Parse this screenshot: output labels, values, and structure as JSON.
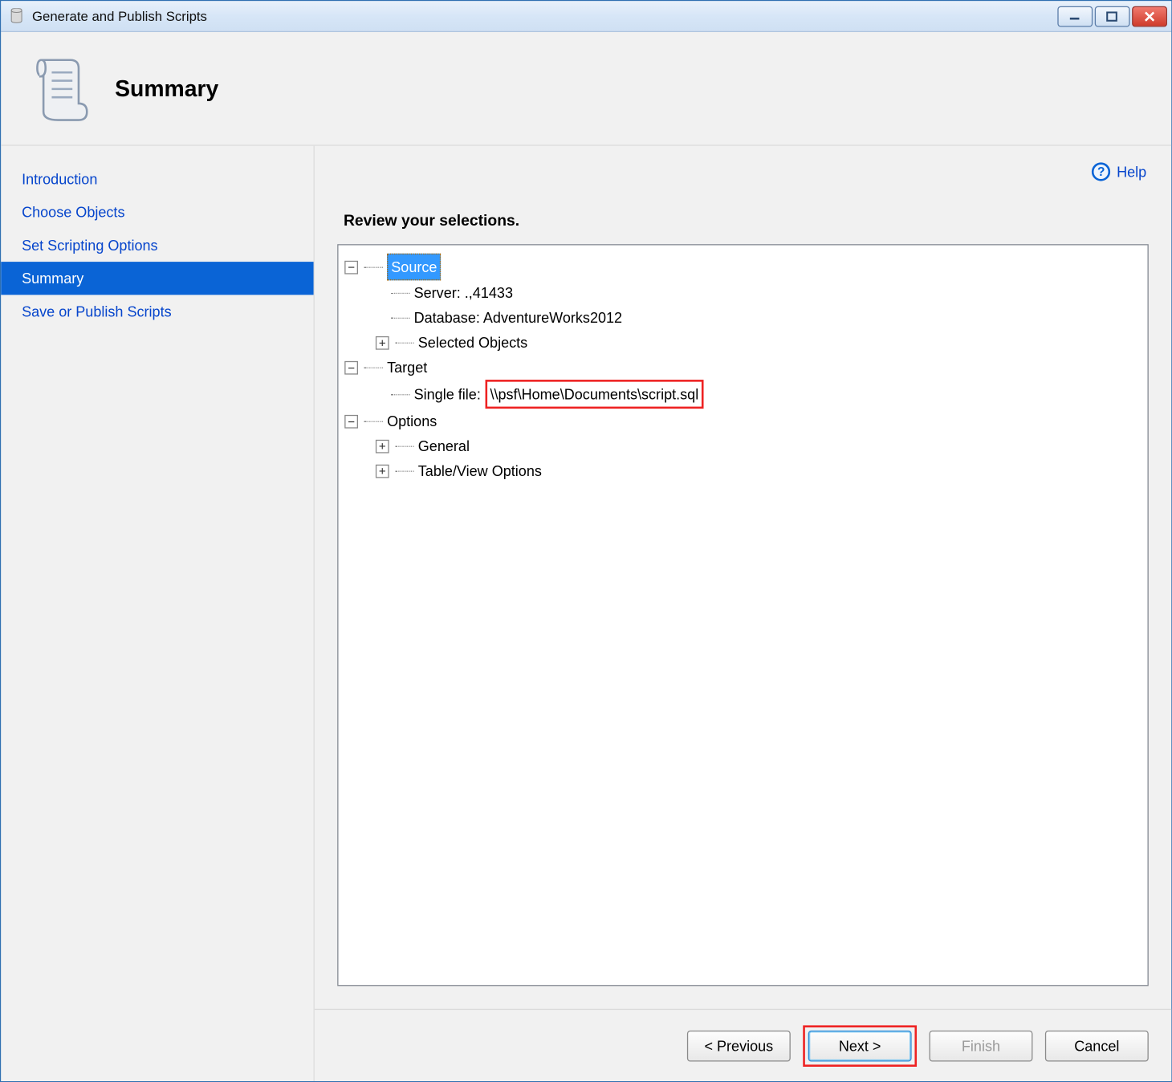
{
  "window": {
    "title": "Generate and Publish Scripts"
  },
  "header": {
    "title": "Summary"
  },
  "sidebar": {
    "items": [
      {
        "label": "Introduction",
        "active": false
      },
      {
        "label": "Choose Objects",
        "active": false
      },
      {
        "label": "Set Scripting Options",
        "active": false
      },
      {
        "label": "Summary",
        "active": true
      },
      {
        "label": "Save or Publish Scripts",
        "active": false
      }
    ]
  },
  "help": {
    "label": "Help"
  },
  "content": {
    "instruction": "Review your selections.",
    "tree": {
      "source": {
        "label": "Source",
        "server": "Server: .,41433",
        "database": "Database: AdventureWorks2012",
        "selected_objects": "Selected Objects"
      },
      "target": {
        "label": "Target",
        "single_file_label": "Single file:",
        "single_file_path": "\\\\psf\\Home\\Documents\\script.sql"
      },
      "options": {
        "label": "Options",
        "general": "General",
        "tableview": "Table/View Options"
      }
    }
  },
  "footer": {
    "previous": "< Previous",
    "next": "Next >",
    "finish": "Finish",
    "cancel": "Cancel"
  }
}
